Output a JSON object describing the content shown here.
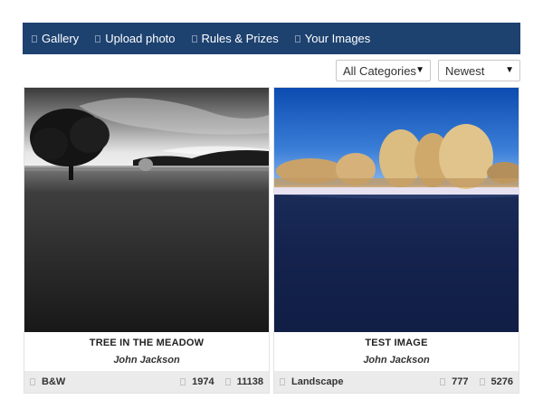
{
  "nav": {
    "items": [
      {
        "label": "Gallery",
        "icon": "camera-icon"
      },
      {
        "label": "Upload photo",
        "icon": "upload-icon"
      },
      {
        "label": "Rules & Prizes",
        "icon": "trophy-icon"
      },
      {
        "label": "Your Images",
        "icon": "user-images-icon"
      }
    ]
  },
  "filters": {
    "category": "All Categories",
    "sort": "Newest"
  },
  "cards": [
    {
      "title": "TREE IN THE MEADOW",
      "author": "John Jackson",
      "category": "B&W",
      "views": "1974",
      "likes": "11138"
    },
    {
      "title": "TEST IMAGE",
      "author": "John Jackson",
      "category": "Landscape",
      "views": "777",
      "likes": "5276"
    }
  ],
  "colors": {
    "navbar": "#1d4270",
    "footer": "#ebebeb"
  }
}
